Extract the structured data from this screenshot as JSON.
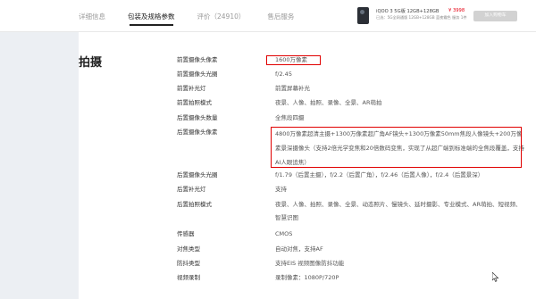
{
  "tabs": [
    {
      "label": "详细信息",
      "active": false
    },
    {
      "label": "包装及规格参数",
      "active": true
    },
    {
      "label": "评价（24910）",
      "active": false
    },
    {
      "label": "售后服务",
      "active": false
    }
  ],
  "product": {
    "name": "iQOO 3 5G版 12GB+128GB",
    "price": "¥ 3998",
    "desc": "已选：5G全网通版 12GB+128GB 蓝夜霜色 服务 1件",
    "buy_button": "加入购物车"
  },
  "section_title": "拍摄",
  "specs": [
    {
      "label": "前置摄像头像素",
      "value": "1600万像素"
    },
    {
      "label": "前置摄像头光圈",
      "value": "f/2.45"
    },
    {
      "label": "前置补光灯",
      "value": "前置屏幕补光"
    },
    {
      "label": "前置拍照模式",
      "value": "夜景、人像、拍照、录像、全景、AR萌拍"
    },
    {
      "label": "后置摄像头数量",
      "value": "全焦段四摄"
    },
    {
      "label": "后置摄像头像素",
      "value": "4800万像素超清主摄+1300万像素超广角AF镜头+1300万像素50mm焦段人像镜头+200万像素景深摄像头（支持2倍光学变焦和20倍数码变焦，实现了从超广端到标准端的全焦段覆盖，支持AI人眼追焦）"
    },
    {
      "label": "后置摄像头光圈",
      "value": "f/1.79（后置主摄），f/2.2（后置广角），f/2.46（后置人像），f/2.4（后置景深）"
    },
    {
      "label": "后置补光灯",
      "value": "支持"
    },
    {
      "label": "后置拍照模式",
      "value": "夜景、人像、拍照、录像、全景、动态照片、慢镜头、延时摄影、专业模式、AR萌拍、短视频、智慧识图"
    },
    {
      "label": "传感器",
      "value": "CMOS"
    },
    {
      "label": "对焦类型",
      "value": "自动对焦，支持AF"
    },
    {
      "label": "防抖类型",
      "value": "支持EIS 视频图像防抖功能"
    },
    {
      "label": "视频录制",
      "value": "录制像素：1080P/720P"
    }
  ],
  "colors": {
    "highlight": "#e00000",
    "price": "#e60012",
    "background": "#eceff3"
  }
}
